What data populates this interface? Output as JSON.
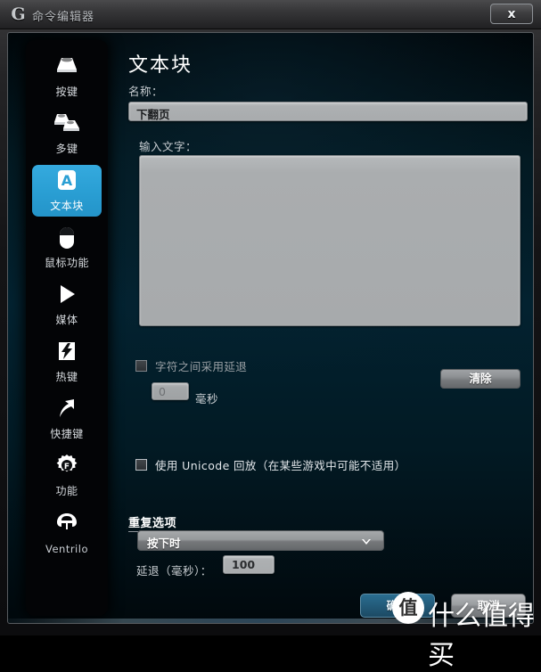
{
  "window": {
    "title": "命令编辑器",
    "logo": "logitech-g-logo",
    "close_label": "x"
  },
  "sidebar": {
    "items": [
      {
        "label": "按键",
        "icon": "keycap-icon",
        "selected": false
      },
      {
        "label": "多键",
        "icon": "multikey-icon",
        "selected": false
      },
      {
        "label": "文本块",
        "icon": "text-block-a-icon",
        "selected": true
      },
      {
        "label": "鼠标功能",
        "icon": "mouse-icon",
        "selected": false
      },
      {
        "label": "媒体",
        "icon": "play-icon",
        "selected": false
      },
      {
        "label": "热键",
        "icon": "hotkey-bolt-icon",
        "selected": false
      },
      {
        "label": "快捷键",
        "icon": "shortcut-arrow-icon",
        "selected": false
      },
      {
        "label": "功能",
        "icon": "gear-f-icon",
        "selected": false
      },
      {
        "label": "Ventrilo",
        "icon": "headset-icon",
        "selected": false
      }
    ]
  },
  "main": {
    "page_title": "文本块",
    "name_label": "名称：",
    "name_value": "下翻页",
    "text_input_label": "输入文字：",
    "text_area_value": "",
    "clear_button": "清除",
    "delay_between_chars_label": "字符之间采用延退",
    "delay_between_chars_checked": false,
    "delay_value": "0",
    "milliseconds_label": "毫秒",
    "unicode_label": "使用 Unicode 回放（在某些游戏中可能不适用）",
    "unicode_checked": false,
    "repeat_section_title": "重复选项",
    "repeat_mode_selected": "按下时",
    "repeat_mode_options": [
      "按下时"
    ],
    "repeat_delay_label": "延退（毫秒）：",
    "repeat_delay_value": "100",
    "ok_button": "确定",
    "cancel_button": "取消"
  },
  "watermark": {
    "badge": "值",
    "text": "什么值得买"
  },
  "colors": {
    "accent_blue": "#2a9fd4",
    "ok_button_blue": "#245d7c",
    "panel_bg": "#032230",
    "field_gray": "#adb0b2"
  }
}
